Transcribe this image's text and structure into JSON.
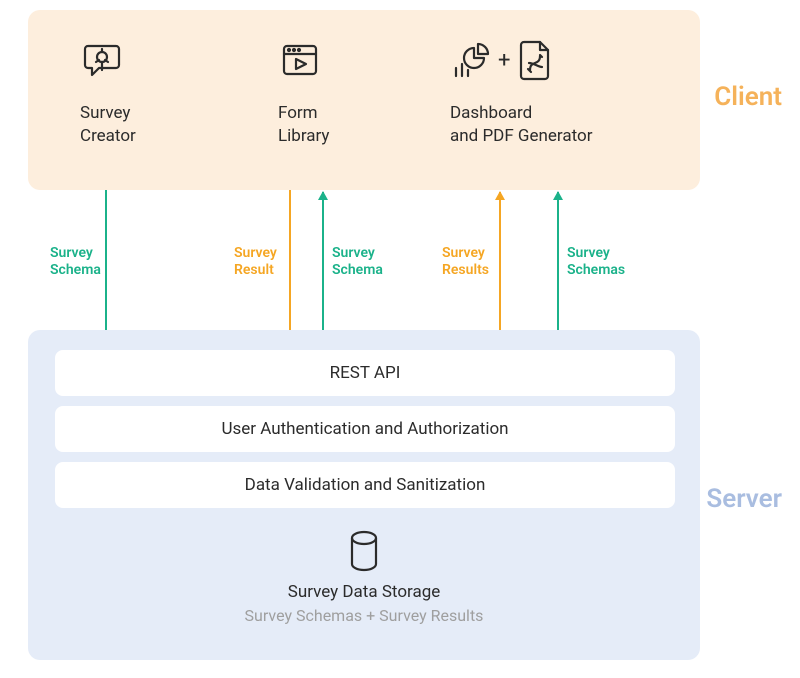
{
  "client": {
    "label": "Client",
    "items": {
      "survey_creator": {
        "title": "Survey\nCreator"
      },
      "form_library": {
        "title": "Form\nLibrary"
      },
      "dashboard_pdf": {
        "title": "Dashboard\nand PDF Generator",
        "plus": "+"
      }
    }
  },
  "server": {
    "label": "Server",
    "rows": {
      "rest_api": "REST API",
      "auth": "User Authentication and Authorization",
      "validation": "Data Validation and Sanitization"
    },
    "storage": {
      "title": "Survey Data Storage",
      "subtitle": "Survey Schemas + Survey Results"
    }
  },
  "arrows": {
    "a1": "Survey\nSchema",
    "a2": "Survey\nResult",
    "a3": "Survey\nSchema",
    "a4": "Survey\nResults",
    "a5": "Survey\nSchemas"
  }
}
